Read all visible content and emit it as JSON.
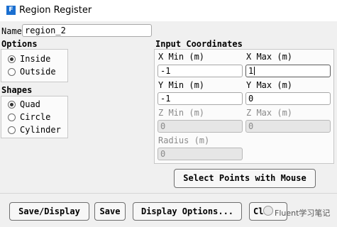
{
  "window": {
    "title": "Region Register",
    "icon_letter": "F"
  },
  "name": {
    "label": "Name",
    "value": "region_2"
  },
  "options": {
    "header": "Options",
    "items": [
      {
        "label": "Inside",
        "selected": true
      },
      {
        "label": "Outside",
        "selected": false
      }
    ]
  },
  "shapes": {
    "header": "Shapes",
    "items": [
      {
        "label": "Quad",
        "selected": true
      },
      {
        "label": "Circle",
        "selected": false
      },
      {
        "label": "Cylinder",
        "selected": false
      }
    ]
  },
  "coords": {
    "header": "Input Coordinates",
    "x_min": {
      "label": "X Min (m)",
      "value": "-1"
    },
    "x_max": {
      "label": "X Max (m)",
      "value": "1"
    },
    "y_min": {
      "label": "Y Min (m)",
      "value": "-1"
    },
    "y_max": {
      "label": "Y Max (m)",
      "value": "0"
    },
    "z_min": {
      "label": "Z Min (m)",
      "value": "0"
    },
    "z_max": {
      "label": "Z Max (m)",
      "value": "0"
    },
    "radius": {
      "label": "Radius (m)",
      "value": "0"
    }
  },
  "buttons": {
    "select_points": "Select Points with Mouse",
    "save_display": "Save/Display",
    "save": "Save",
    "display_options": "Display Options...",
    "close": "Clo"
  },
  "watermark": "Fluent学习笔记"
}
